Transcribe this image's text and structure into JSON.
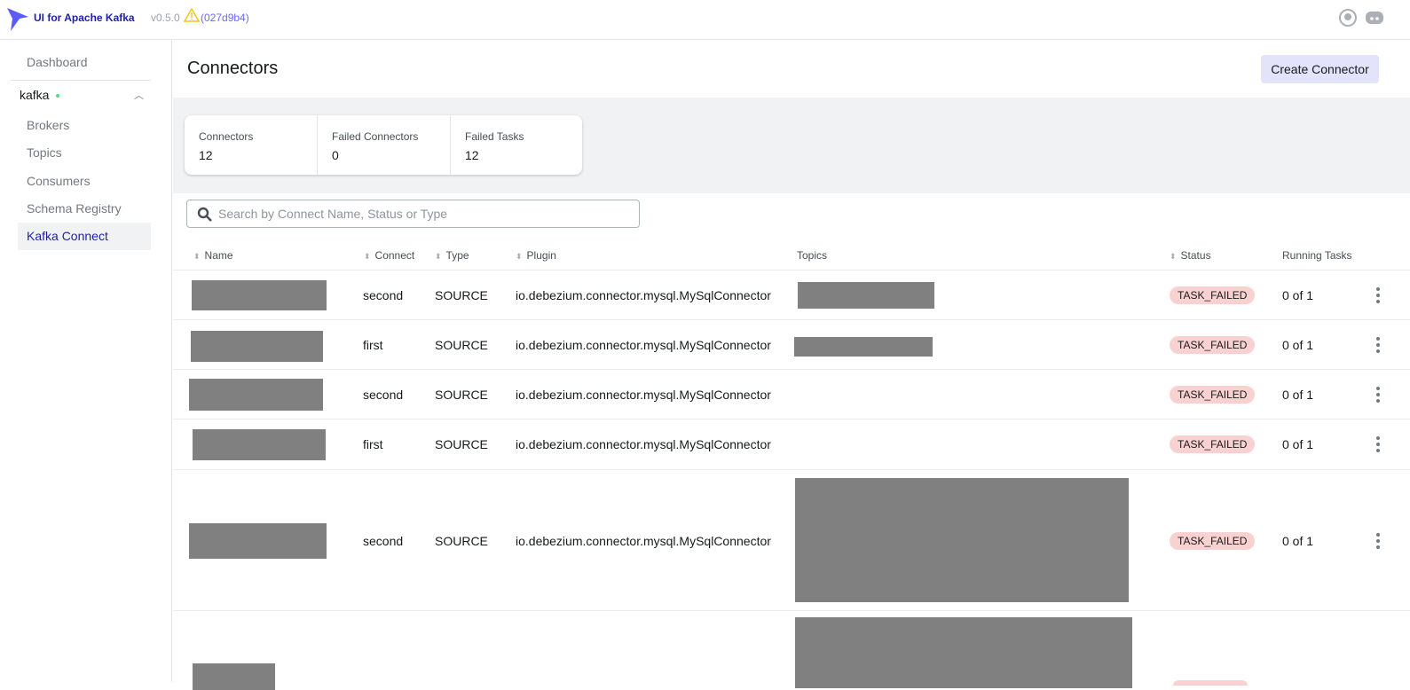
{
  "header": {
    "brand": "UI for Apache Kafka",
    "version": "v0.5.0",
    "commit": "(027d9b4)"
  },
  "sidebar": {
    "dashboard": "Dashboard",
    "cluster": "kafka",
    "items": [
      {
        "label": "Brokers"
      },
      {
        "label": "Topics"
      },
      {
        "label": "Consumers"
      },
      {
        "label": "Schema Registry"
      },
      {
        "label": "Kafka Connect"
      }
    ]
  },
  "page": {
    "title": "Connectors",
    "create_label": "Create Connector"
  },
  "stats": [
    {
      "label": "Connectors",
      "value": "12"
    },
    {
      "label": "Failed Connectors",
      "value": "0"
    },
    {
      "label": "Failed Tasks",
      "value": "12"
    }
  ],
  "search": {
    "placeholder": "Search by Connect Name, Status or Type",
    "value": ""
  },
  "table": {
    "headers": {
      "name": "Name",
      "connect": "Connect",
      "type": "Type",
      "plugin": "Plugin",
      "topics": "Topics",
      "status": "Status",
      "running": "Running Tasks"
    },
    "rows": [
      {
        "connect": "second",
        "type": "SOURCE",
        "plugin": "io.debezium.connector.mysql.MySqlConnector",
        "status": "TASK_FAILED",
        "running": "0 of 1"
      },
      {
        "connect": "first",
        "type": "SOURCE",
        "plugin": "io.debezium.connector.mysql.MySqlConnector",
        "status": "TASK_FAILED",
        "running": "0 of 1"
      },
      {
        "connect": "second",
        "type": "SOURCE",
        "plugin": "io.debezium.connector.mysql.MySqlConnector",
        "status": "TASK_FAILED",
        "running": "0 of 1"
      },
      {
        "connect": "first",
        "type": "SOURCE",
        "plugin": "io.debezium.connector.mysql.MySqlConnector",
        "status": "TASK_FAILED",
        "running": "0 of 1"
      },
      {
        "connect": "second",
        "type": "SOURCE",
        "plugin": "io.debezium.connector.mysql.MySqlConnector",
        "status": "TASK_FAILED",
        "running": "0 of 1"
      }
    ]
  }
}
